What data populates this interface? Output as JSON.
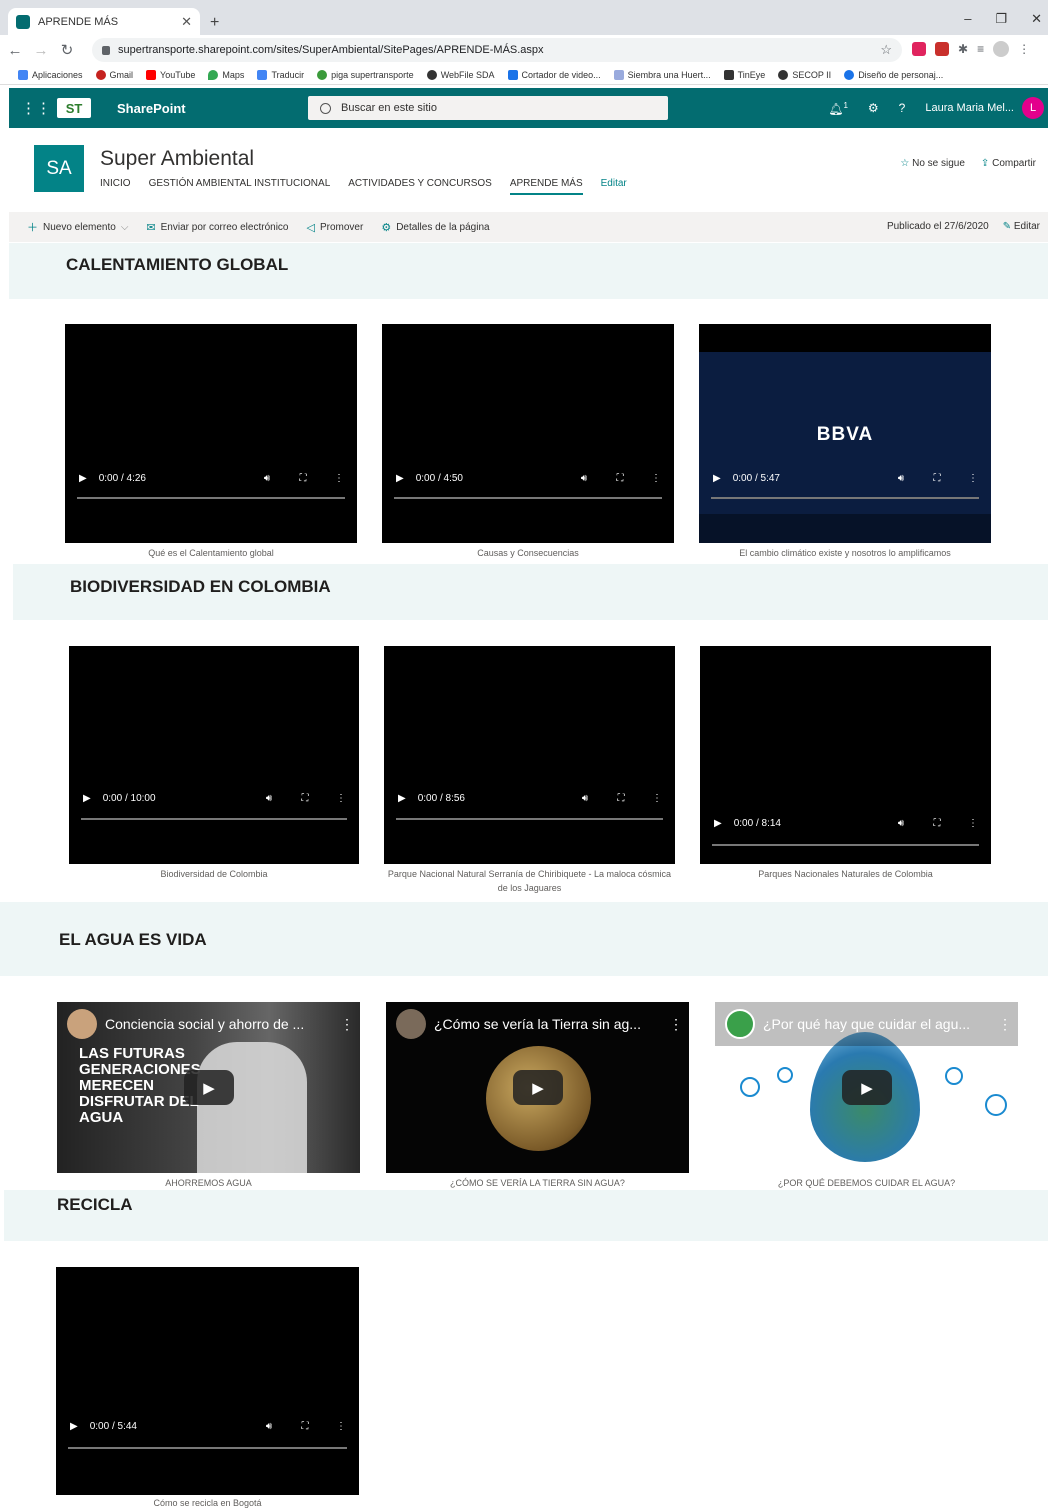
{
  "browser": {
    "tab_title": "APRENDE MÁS",
    "url": "supertransporte.sharepoint.com/sites/SuperAmbiental/SitePages/APRENDE-MÁS.aspx",
    "bookmarks": [
      "Aplicaciones",
      "Gmail",
      "YouTube",
      "Maps",
      "Traducir",
      "piga supertransporte",
      "WebFile SDA",
      "Cortador de video...",
      "Siembra una Huert...",
      "TinEye",
      "SECOP II",
      "Diseño de personaj..."
    ]
  },
  "suitebar": {
    "app_name": "SharePoint",
    "search_placeholder": "Buscar en este sitio",
    "user_name": "Laura Maria Mel...",
    "user_initial": "L",
    "notification_count": "1",
    "help": "?",
    "logo_text": "ST"
  },
  "site": {
    "logo_initials": "SA",
    "title": "Super Ambiental",
    "nav": [
      "INICIO",
      "GESTIÓN AMBIENTAL INSTITUCIONAL",
      "ACTIVIDADES Y CONCURSOS",
      "APRENDE MÁS",
      "Editar"
    ],
    "follow": "No se sigue",
    "share": "Compartir"
  },
  "commandbar": {
    "new_item": "Nuevo elemento",
    "email": "Enviar por correo electrónico",
    "promote": "Promover",
    "page_details": "Detalles de la página",
    "published": "Publicado el 27/6/2020",
    "edit": "Editar"
  },
  "sections": [
    {
      "title": "CALENTAMIENTO GLOBAL",
      "videos": [
        {
          "time": "0:00 / 4:26",
          "caption": "Qué es el Calentamiento global"
        },
        {
          "time": "0:00 / 4:50",
          "caption": "Causas y Consecuencias"
        },
        {
          "time": "0:00 / 5:47",
          "caption": "El cambio climático existe y nosotros lo amplificamos",
          "logo": "BBVA"
        }
      ]
    },
    {
      "title": "BIODIVERSIDAD EN COLOMBIA",
      "videos": [
        {
          "time": "0:00 / 10:00",
          "caption": "Biodiversidad de Colombia"
        },
        {
          "time": "0:00 / 8:56",
          "caption": "Parque Nacional Natural Serranía de Chiribiquete - La maloca cósmica de los Jaguares"
        },
        {
          "time": "0:00 / 8:14",
          "caption": "Parques Nacionales Naturales de Colombia"
        }
      ]
    },
    {
      "title": "EL AGUA ES VIDA",
      "videos": [
        {
          "title": "Conciencia social y ahorro de ...",
          "caption": "AHORREMOS AGUA",
          "overlay": "LAS FUTURAS GENERACIONES MERECEN DISFRUTAR DEL AGUA"
        },
        {
          "title": "¿Cómo se vería la Tierra sin ag...",
          "caption": "¿CÓMO SE VERÍA LA TIERRA SIN AGUA?"
        },
        {
          "title": "¿Por qué hay que cuidar el agu...",
          "caption": "¿POR QUÉ DEBEMOS CUIDAR EL AGUA?"
        }
      ]
    },
    {
      "title": "RECICLA",
      "videos": [
        {
          "time": "0:00 / 5:44",
          "caption": "Cómo se recicla en Bogotá"
        }
      ]
    }
  ]
}
